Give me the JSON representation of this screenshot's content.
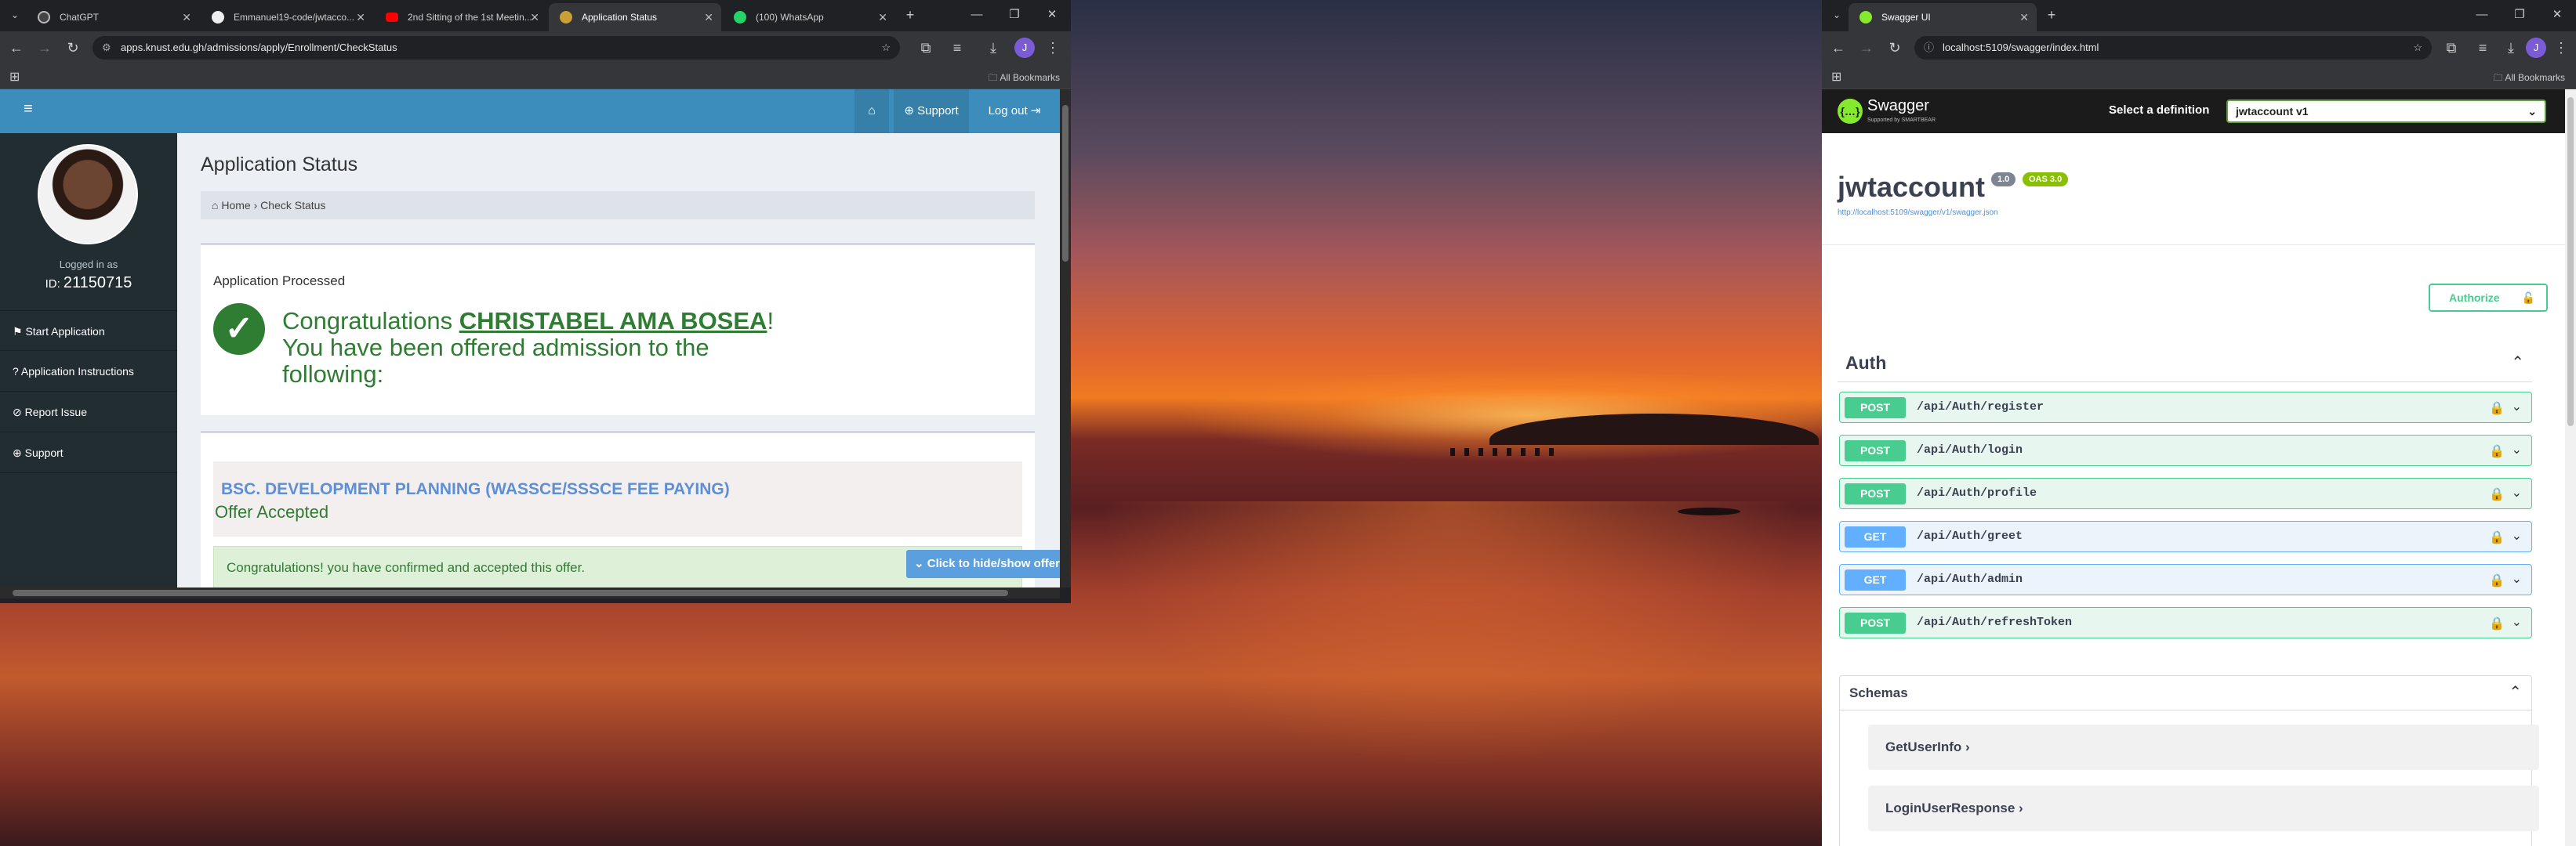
{
  "left_browser": {
    "tabs": [
      {
        "label": "ChatGPT",
        "icon": "chatgpt-icon"
      },
      {
        "label": "Emmanuel19-code/jwtacco...",
        "icon": "github-icon"
      },
      {
        "label": "2nd Sitting of the 1st Meetin...",
        "icon": "youtube-icon"
      },
      {
        "label": "Application Status",
        "icon": "knust-icon"
      },
      {
        "label": "(100) WhatsApp",
        "icon": "whatsapp-icon"
      }
    ],
    "url": "apps.knust.edu.gh/admissions/apply/Enrollment/CheckStatus",
    "bookmarks_label": "All Bookmarks"
  },
  "knust": {
    "nav_support": "Support",
    "nav_logout": "Log out",
    "logged_in_as": "Logged in as",
    "id_prefix": "ID:",
    "id_value": "21150715",
    "menu": [
      {
        "label": "Start Application"
      },
      {
        "label": "Application Instructions"
      },
      {
        "label": "Report Issue"
      },
      {
        "label": "Support"
      }
    ],
    "page_title": "Application Status",
    "breadcrumb_home": "Home",
    "breadcrumb_sep": "›",
    "breadcrumb_current": "Check Status",
    "status_heading": "Application Processed",
    "congrats_prefix": "Congratulations ",
    "applicant_name": "CHRISTABEL AMA BOSEA",
    "congrats_suffix": "! You have been offered admission to the following:",
    "toggle_button": "Click to hide/show offer d",
    "program": "BSC. DEVELOPMENT PLANNING (WASSCE/SSSCE FEE PAYING)",
    "offer_status": "Offer Accepted",
    "confirm_message": "Congratulations! you have confirmed and accepted this offer."
  },
  "right_browser": {
    "tab_label": "Swagger UI",
    "url": "localhost:5109/swagger/index.html",
    "bookmarks_label": "All Bookmarks"
  },
  "swagger": {
    "logo_text": "Swagger",
    "logo_sub": "Supported by SMARTBEAR",
    "select_label": "Select a definition",
    "definition": "jwtaccount v1",
    "api_title": "jwtaccount",
    "version_badge": "1.0",
    "oas_badge": "OAS 3.0",
    "spec_link": "http://localhost:5109/swagger/v1/swagger.json",
    "authorize": "Authorize",
    "section": "Auth",
    "endpoints": [
      {
        "method": "POST",
        "path": "/api/Auth/register"
      },
      {
        "method": "POST",
        "path": "/api/Auth/login"
      },
      {
        "method": "POST",
        "path": "/api/Auth/profile"
      },
      {
        "method": "GET",
        "path": "/api/Auth/greet"
      },
      {
        "method": "GET",
        "path": "/api/Auth/admin"
      },
      {
        "method": "POST",
        "path": "/api/Auth/refreshToken"
      }
    ],
    "schemas_label": "Schemas",
    "schemas": [
      {
        "name": "GetUserInfo"
      },
      {
        "name": "LoginUserResponse"
      }
    ]
  },
  "colors": {
    "adminlte_blue": "#3c8dbc",
    "sidebar_dark": "#222d32",
    "success_green": "#2e7d32",
    "post_green": "#49cc90",
    "get_blue": "#61affe",
    "swagger_badge_green": "#89bf04"
  }
}
